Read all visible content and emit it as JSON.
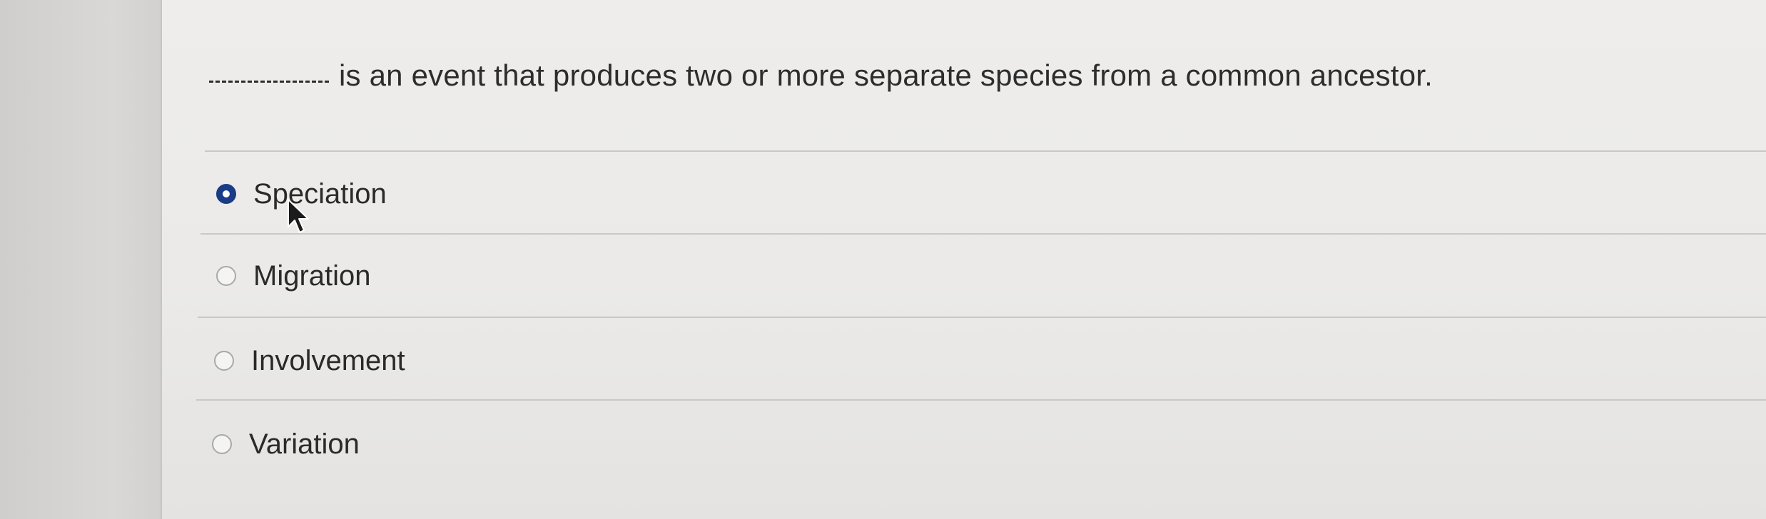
{
  "question": {
    "blank": "________",
    "text": "is an event that produces two or more separate species from a common ancestor."
  },
  "options": [
    {
      "label": "Speciation",
      "selected": true
    },
    {
      "label": "Migration",
      "selected": false
    },
    {
      "label": "Involvement",
      "selected": false
    },
    {
      "label": "Variation",
      "selected": false
    }
  ],
  "colors": {
    "radio_selected": "#1a3c86",
    "text": "#2d2d2d"
  },
  "icons": {
    "cursor": "mouse-pointer-icon"
  }
}
